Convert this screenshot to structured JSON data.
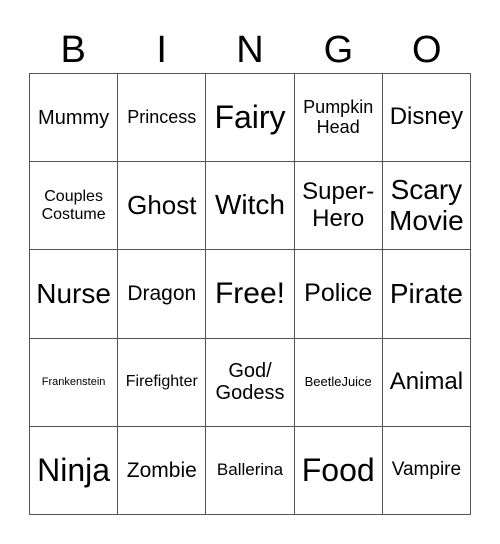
{
  "header": {
    "letters": [
      "B",
      "I",
      "N",
      "G",
      "O"
    ]
  },
  "card": {
    "cells": [
      "Mummy",
      "Princess",
      "Fairy",
      "Pumpkin Head",
      "Disney",
      "Couples Costume",
      "Ghost",
      "Witch",
      "Super-Hero",
      "Scary Movie",
      "Nurse",
      "Dragon",
      "Free!",
      "Police",
      "Pirate",
      "Frankenstein",
      "Firefighter",
      "God/ Godess",
      "BeetleJuice",
      "Animal",
      "Ninja",
      "Zombie",
      "Ballerina",
      "Food",
      "Vampire"
    ]
  }
}
